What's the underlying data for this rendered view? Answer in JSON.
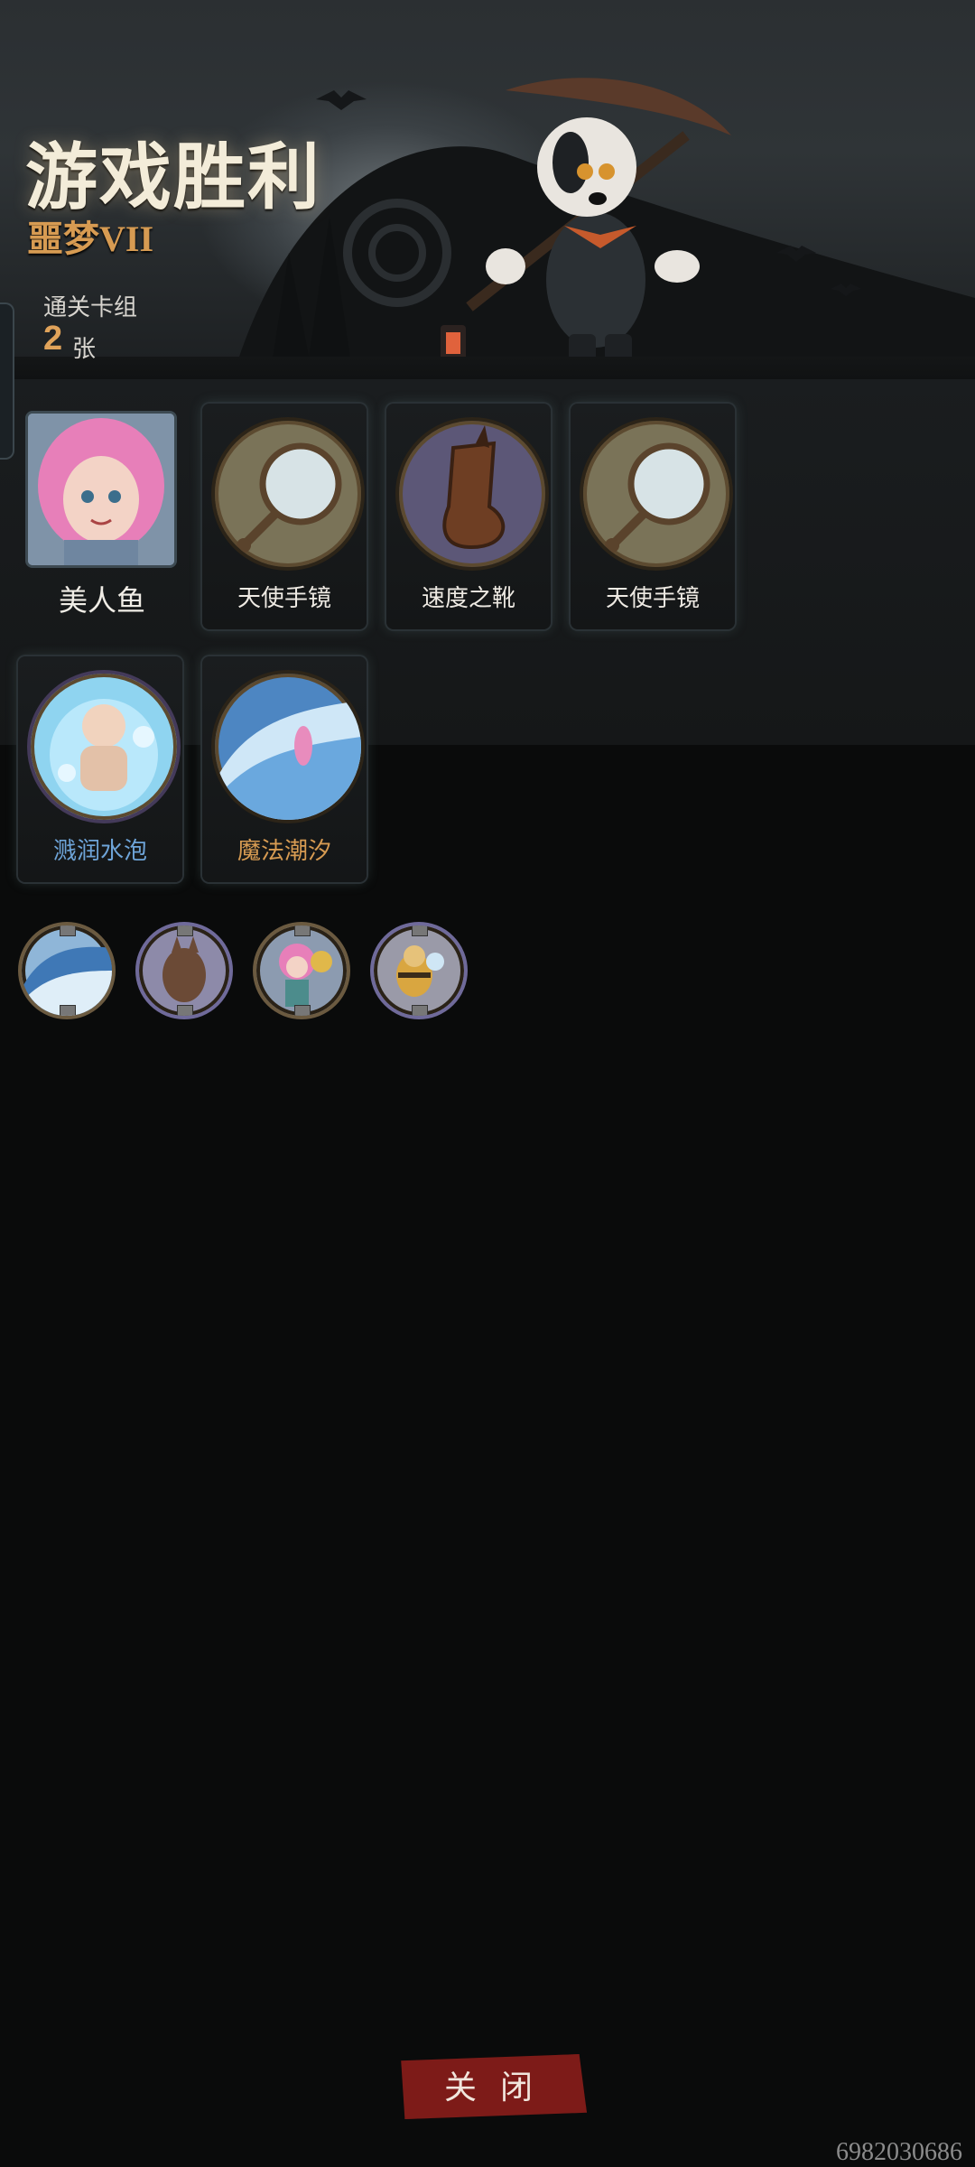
{
  "banner": {
    "title": "游戏胜利",
    "difficulty": "噩梦VII",
    "deck_label": "通关卡组",
    "deck_count": "2",
    "deck_unit": "张"
  },
  "hero": {
    "name": "美人鱼",
    "icon": "mermaid-portrait"
  },
  "cards": [
    {
      "name": "天使手镜",
      "icon": "hand-mirror-icon",
      "color": "default"
    },
    {
      "name": "速度之靴",
      "icon": "boot-icon",
      "color": "default"
    },
    {
      "name": "天使手镜",
      "icon": "hand-mirror-icon",
      "color": "default"
    },
    {
      "name": "溅润水泡",
      "icon": "water-bubble-icon",
      "color": "blue"
    },
    {
      "name": "魔法潮汐",
      "icon": "magic-tide-icon",
      "color": "gold"
    }
  ],
  "tokens": [
    {
      "icon": "wave-token-icon"
    },
    {
      "icon": "werewolf-token-icon"
    },
    {
      "icon": "mermaid-token-icon"
    },
    {
      "icon": "bee-token-icon"
    }
  ],
  "footer": {
    "close_label": "关 闭"
  },
  "watermark": "6982030686",
  "colors": {
    "accent_gold": "#d79b52",
    "close_red": "#7d1b18",
    "blue_text": "#6ea4d8"
  }
}
